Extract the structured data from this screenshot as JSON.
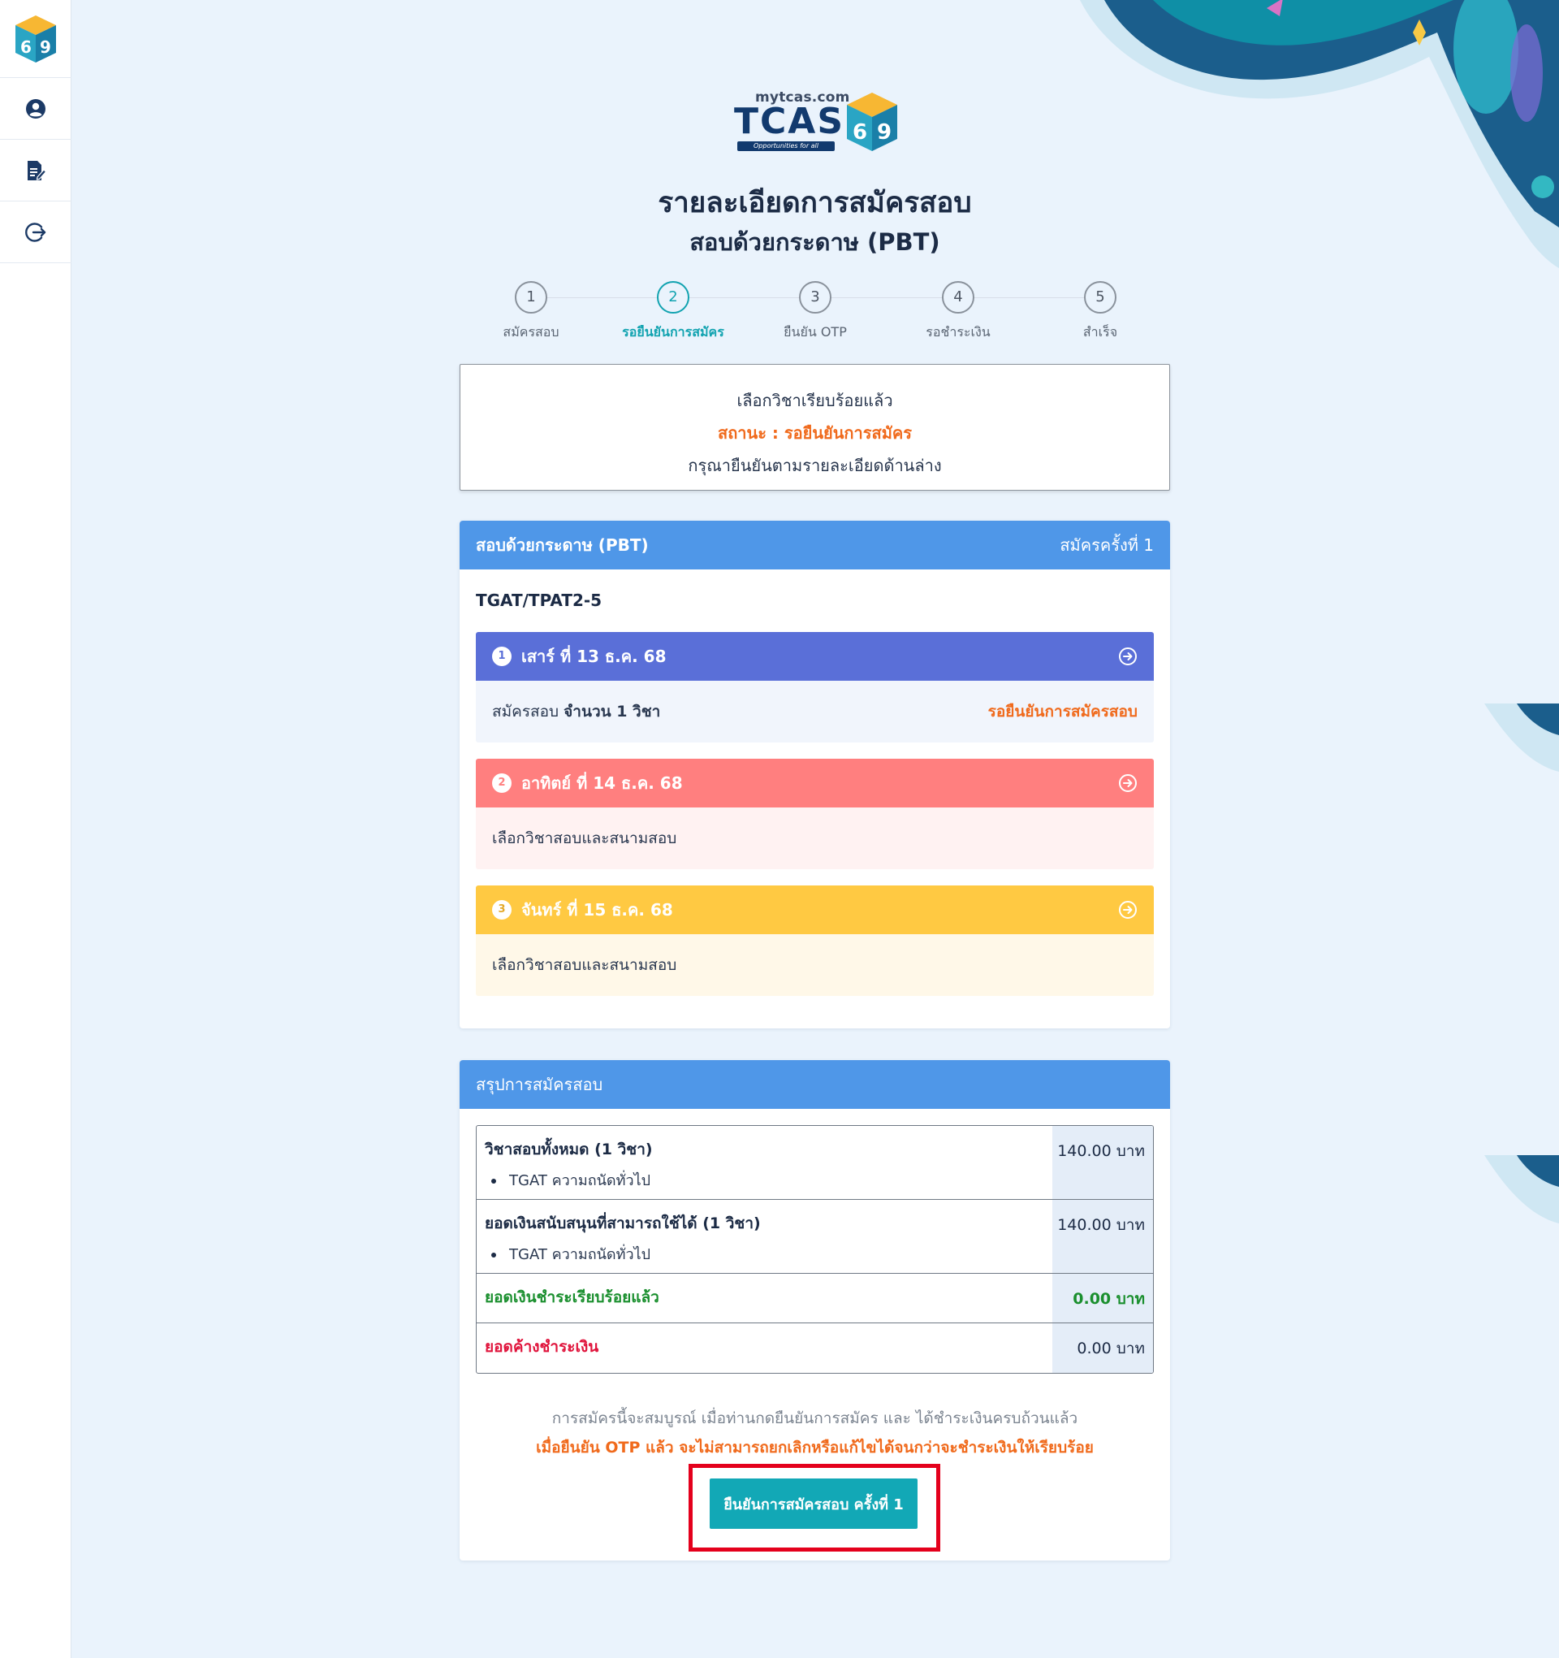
{
  "sidebar": {
    "logo_digits": [
      "6",
      "9"
    ],
    "items": [
      {
        "icon": "user-circle-icon"
      },
      {
        "icon": "edit-document-icon"
      },
      {
        "icon": "logout-icon"
      }
    ]
  },
  "brand": {
    "site": "mytcas.com",
    "word": "TCAS",
    "tagline": "Opportunities for all",
    "digits": [
      "6",
      "9"
    ]
  },
  "page": {
    "title": "รายละเอียดการสมัครสอบ",
    "subtitle": "สอบด้วยกระดาษ (PBT)"
  },
  "steps": [
    {
      "num": "1",
      "label": "สมัครสอบ"
    },
    {
      "num": "2",
      "label": "รอยืนยันการสมัคร"
    },
    {
      "num": "3",
      "label": "ยืนยัน OTP"
    },
    {
      "num": "4",
      "label": "รอชำระเงิน"
    },
    {
      "num": "5",
      "label": "สำเร็จ"
    }
  ],
  "status_box": {
    "line1": "เลือกวิชาเรียบร้อยแล้ว",
    "line2": "สถานะ : รอยืนยันการสมัคร",
    "line3": "กรุณายืนยันตามรายละเอียดด้านล่าง"
  },
  "exam_card": {
    "title": "สอบด้วยกระดาษ (PBT)",
    "round": "สมัครครั้งที่ 1",
    "code": "TGAT/TPAT2-5",
    "days": [
      {
        "num": "1",
        "label": "เสาร์ ที่ 13 ธ.ค. 68",
        "body_prefix": "สมัครสอบ",
        "body_bold": "จำนวน 1 วิชา",
        "status": "รอยืนยันการสมัครสอบ"
      },
      {
        "num": "2",
        "label": "อาทิตย์ ที่ 14 ธ.ค. 68",
        "body": "เลือกวิชาสอบและสนามสอบ"
      },
      {
        "num": "3",
        "label": "จันทร์ ที่ 15 ธ.ค. 68",
        "body": "เลือกวิชาสอบและสนามสอบ"
      }
    ]
  },
  "summary": {
    "title": "สรุปการสมัครสอบ",
    "rows": [
      {
        "label": "วิชาสอบทั้งหมด (1 วิชา)",
        "item": "TGAT ความถนัดทั่วไป",
        "amount": "140.00 บาท"
      },
      {
        "label": "ยอดเงินสนับสนุนที่สามารถใช้ได้ (1 วิชา)",
        "item": "TGAT ความถนัดทั่วไป",
        "amount": "140.00 บาท"
      },
      {
        "label": "ยอดเงินชำระเรียบร้อยแล้ว",
        "amount": "0.00 บาท"
      },
      {
        "label": "ยอดค้างชำระเงิน",
        "amount": "0.00 บาท"
      }
    ],
    "note1": "การสมัครนี้จะสมบูรณ์ เมื่อท่านกดยืนยันการสมัคร และ ได้ชำระเงินครบถ้วนแล้ว",
    "note2": "เมื่อยืนยัน OTP แล้ว จะไม่สามารถยกเลิกหรือแก้ไขได้จนกว่าจะชำระเงินให้เรียบร้อย",
    "confirm_label": "ยืนยันการสมัครสอบ ครั้งที่ 1"
  },
  "colors": {
    "header_blue": "#4f97e8",
    "accent_teal": "#12a8b6",
    "day1": "#5a6fd8",
    "day2": "#ff7f7f",
    "day3": "#ffc942",
    "warning_orange": "#f06a1c",
    "highlight_red": "#e4001c"
  }
}
